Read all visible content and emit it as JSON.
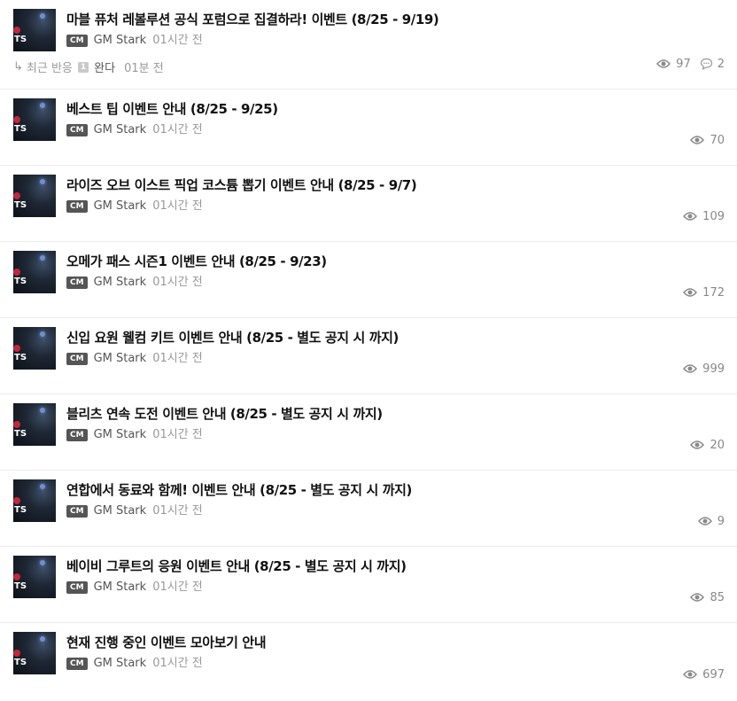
{
  "posts": [
    {
      "title": "마블 퓨처 레볼루션 공식 포럼으로 집결하라! 이벤트 (8/25 - 9/19)",
      "badge": "CM",
      "author": "GM Stark",
      "time": "01시간 전",
      "views": "97",
      "comments": "2",
      "reply": {
        "arrow": "↳",
        "label": "최근 반응",
        "count": "1",
        "name": "완다",
        "time": "01분 전"
      }
    },
    {
      "title": "베스트 팁 이벤트 안내 (8/25 - 9/25)",
      "badge": "CM",
      "author": "GM Stark",
      "time": "01시간 전",
      "views": "70"
    },
    {
      "title": "라이즈 오브 이스트 픽업 코스튬 뽑기 이벤트 안내 (8/25 - 9/7)",
      "badge": "CM",
      "author": "GM Stark",
      "time": "01시간 전",
      "views": "109"
    },
    {
      "title": "오메가 패스 시즌1 이벤트 안내 (8/25 - 9/23)",
      "badge": "CM",
      "author": "GM Stark",
      "time": "01시간 전",
      "views": "172"
    },
    {
      "title": "신입 요원 웰컴 키트 이벤트 안내 (8/25 - 별도 공지 시 까지)",
      "badge": "CM",
      "author": "GM Stark",
      "time": "01시간 전",
      "views": "999"
    },
    {
      "title": "블리츠 연속 도전 이벤트 안내 (8/25 - 별도 공지 시 까지)",
      "badge": "CM",
      "author": "GM Stark",
      "time": "01시간 전",
      "views": "20"
    },
    {
      "title": "연합에서 동료와 함께! 이벤트 안내 (8/25 - 별도 공지 시 까지)",
      "badge": "CM",
      "author": "GM Stark",
      "time": "01시간 전",
      "views": "9"
    },
    {
      "title": "베이비 그루트의 응원 이벤트 안내 (8/25 - 별도 공지 시 까지)",
      "badge": "CM",
      "author": "GM Stark",
      "time": "01시간 전",
      "views": "85"
    },
    {
      "title": "현재 진행 중인 이벤트 모아보기 안내",
      "badge": "CM",
      "author": "GM Stark",
      "time": "01시간 전",
      "views": "697"
    }
  ],
  "thumb_text": "TS",
  "icons": {
    "views": "eye-icon",
    "comments": "comment-icon",
    "reply": "reply-arrow-icon"
  }
}
